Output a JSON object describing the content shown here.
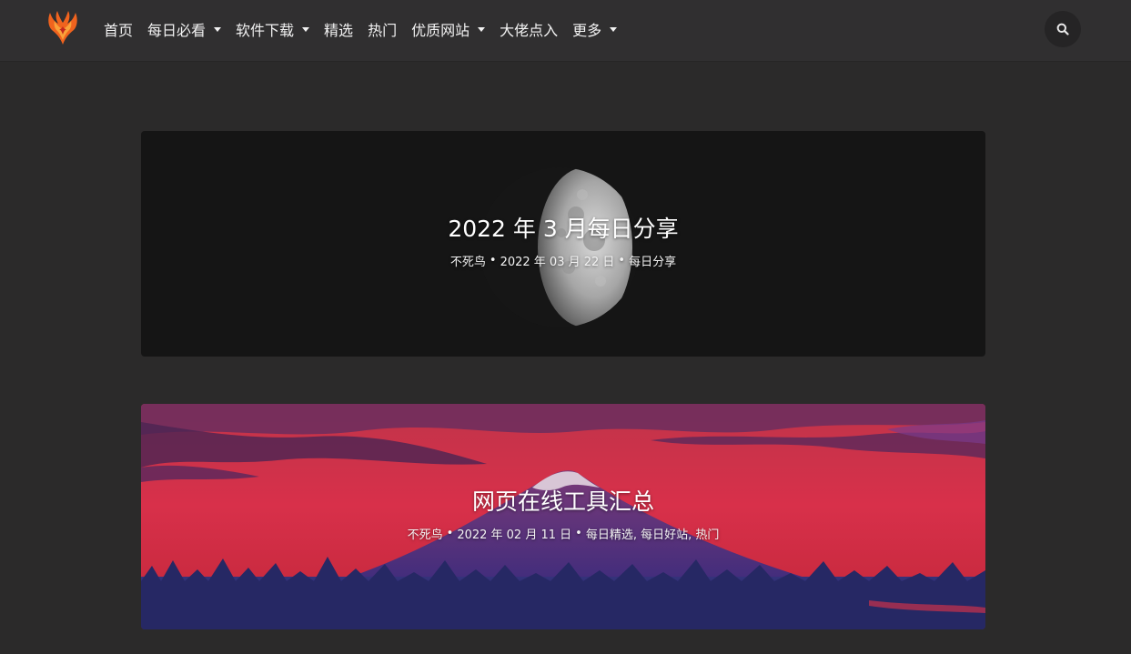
{
  "nav": {
    "items": [
      {
        "label": "首页",
        "dropdown": false
      },
      {
        "label": "每日必看",
        "dropdown": true
      },
      {
        "label": "软件下载",
        "dropdown": true
      },
      {
        "label": "精选",
        "dropdown": false
      },
      {
        "label": "热门",
        "dropdown": false
      },
      {
        "label": "优质网站",
        "dropdown": true
      },
      {
        "label": "大佬点入",
        "dropdown": false
      },
      {
        "label": "更多",
        "dropdown": true
      }
    ],
    "search_icon": "search-icon",
    "logo_icon": "phoenix-logo-icon"
  },
  "posts": [
    {
      "title": "2022 年 3 月每日分享",
      "author": "不死鸟",
      "date": "2022 年 03 月 22 日",
      "category": "每日分享",
      "thumbnail": "half-moon-on-dark-sky"
    },
    {
      "title": "网页在线工具汇总",
      "author": "不死鸟",
      "date": "2022 年 02 月 11 日",
      "category": "每日精选, 每日好站, 热门",
      "thumbnail": "mountain-at-red-sunset"
    }
  ],
  "colors": {
    "page_bg": "#2b2a2a",
    "topbar_bg": "#302f30",
    "logo_orange": "#f0631e"
  }
}
